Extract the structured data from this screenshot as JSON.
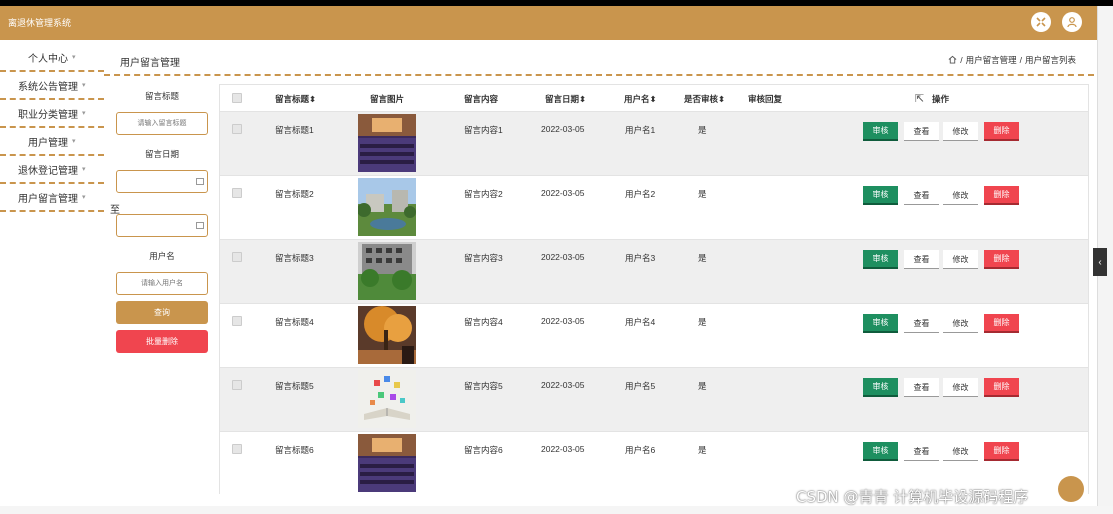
{
  "app": {
    "title": "离退休管理系统"
  },
  "header": {
    "icons": [
      "expand-icon",
      "user-icon"
    ]
  },
  "menu": {
    "items": [
      {
        "label": "个人中心",
        "caret": "▾"
      },
      {
        "label": "系统公告管理",
        "caret": "▾"
      },
      {
        "label": "职业分类管理",
        "caret": "▾"
      },
      {
        "label": "用户管理",
        "caret": "▾"
      },
      {
        "label": "退休登记管理",
        "caret": "▾"
      },
      {
        "label": "用户留言管理",
        "caret": "▾"
      }
    ]
  },
  "page": {
    "title": "用户留言管理",
    "breadcrumb_sep": "/",
    "breadcrumb": [
      "用户留言管理",
      "用户留言列表"
    ]
  },
  "filter": {
    "title_label": "留言标题",
    "title_placeholder": "请输入留言标题",
    "date_label": "留言日期",
    "to_label": "至",
    "user_label": "用户名",
    "user_placeholder": "请输入用户名",
    "query_button": "查询",
    "batch_delete_button": "批量删除"
  },
  "table": {
    "headers": {
      "title": "留言标题",
      "image": "留言图片",
      "content": "留言内容",
      "date": "留言日期",
      "user": "用户名",
      "reviewed": "是否审核",
      "reply": "审核回复",
      "actions": "操作"
    },
    "sort_mark": "⬍",
    "actions": {
      "review": "审核",
      "view": "查看",
      "edit": "修改",
      "delete": "删除"
    },
    "rows": [
      {
        "title": "留言标题1",
        "image": "auditorium",
        "content": "留言内容1",
        "date": "2022-03-05",
        "user": "用户名1",
        "reviewed": "是",
        "reply": ""
      },
      {
        "title": "留言标题2",
        "image": "campus",
        "content": "留言内容2",
        "date": "2022-03-05",
        "user": "用户名2",
        "reviewed": "是",
        "reply": ""
      },
      {
        "title": "留言标题3",
        "image": "building",
        "content": "留言内容3",
        "date": "2022-03-05",
        "user": "用户名3",
        "reviewed": "是",
        "reply": ""
      },
      {
        "title": "留言标题4",
        "image": "autumn-tree",
        "content": "留言内容4",
        "date": "2022-03-05",
        "user": "用户名4",
        "reviewed": "是",
        "reply": ""
      },
      {
        "title": "留言标题5",
        "image": "book",
        "content": "留言内容5",
        "date": "2022-03-05",
        "user": "用户名5",
        "reviewed": "是",
        "reply": ""
      },
      {
        "title": "留言标题6",
        "image": "auditorium",
        "content": "留言内容6",
        "date": "2022-03-05",
        "user": "用户名6",
        "reviewed": "是",
        "reply": ""
      }
    ]
  },
  "watermark": "CSDN @青青  计算机毕设源码程序",
  "colors": {
    "brand": "#c9954d",
    "review": "#1e8f60",
    "delete": "#f0454f"
  }
}
